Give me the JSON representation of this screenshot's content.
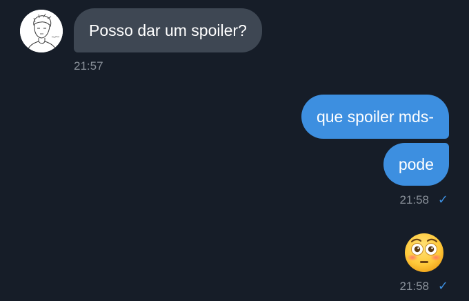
{
  "chat": {
    "incoming": {
      "text": "Posso dar um spoiler?",
      "time": "21:57"
    },
    "outgoing": [
      {
        "text": "que spoiler mds-"
      },
      {
        "text": "pode",
        "time": "21:58",
        "status": "✓"
      }
    ],
    "emoji_message": {
      "emoji": "flushed-face",
      "time": "21:58",
      "status": "✓"
    }
  },
  "colors": {
    "background": "#161d28",
    "incoming_bubble": "#3e4753",
    "outgoing_bubble": "#3d8fe0",
    "timestamp": "#8a919a",
    "checkmark": "#3d8fe0"
  },
  "icons": {
    "avatar": "sketch-portrait-avatar",
    "read_receipt": "check-icon",
    "emoji": "flushed-face-emoji"
  }
}
